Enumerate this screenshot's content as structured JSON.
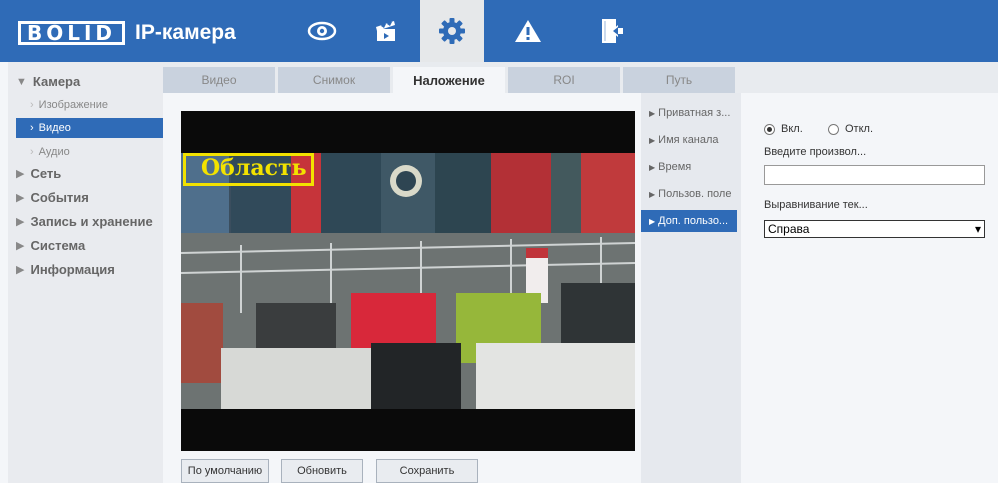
{
  "header": {
    "logo_text": "BOLID",
    "title": "IP-камера",
    "nav_icons": [
      "eye-icon",
      "clapperboard-icon",
      "gear-icon",
      "warning-icon",
      "exit-icon"
    ]
  },
  "sidebar": {
    "camera": {
      "label": "Камера",
      "items": [
        {
          "label": "Изображение"
        },
        {
          "label": "Видео"
        },
        {
          "label": "Аудио"
        }
      ]
    },
    "groups": [
      {
        "label": "Сеть"
      },
      {
        "label": "События"
      },
      {
        "label": "Запись и хранение"
      },
      {
        "label": "Система"
      },
      {
        "label": "Информация"
      }
    ]
  },
  "tabs": [
    {
      "label": "Видео"
    },
    {
      "label": "Снимок"
    },
    {
      "label": "Наложение"
    },
    {
      "label": "ROI"
    },
    {
      "label": "Путь"
    }
  ],
  "video": {
    "overlay_text": "Область"
  },
  "overlay_options": [
    {
      "label": "Приватная з..."
    },
    {
      "label": "Имя канала"
    },
    {
      "label": "Время"
    },
    {
      "label": "Пользов. поле"
    },
    {
      "label": "Доп. пользо..."
    }
  ],
  "settings": {
    "radio_on": "Вкл.",
    "radio_off": "Откл.",
    "text_label": "Введите произвол...",
    "text_value": "",
    "align_label": "Выравнивание тек...",
    "align_value": "Справа"
  },
  "buttons": {
    "default": "По умолчанию",
    "refresh": "Обновить",
    "save": "Сохранить"
  },
  "colors": {
    "accent": "#2f6bb7",
    "overlay": "#f2e200"
  }
}
